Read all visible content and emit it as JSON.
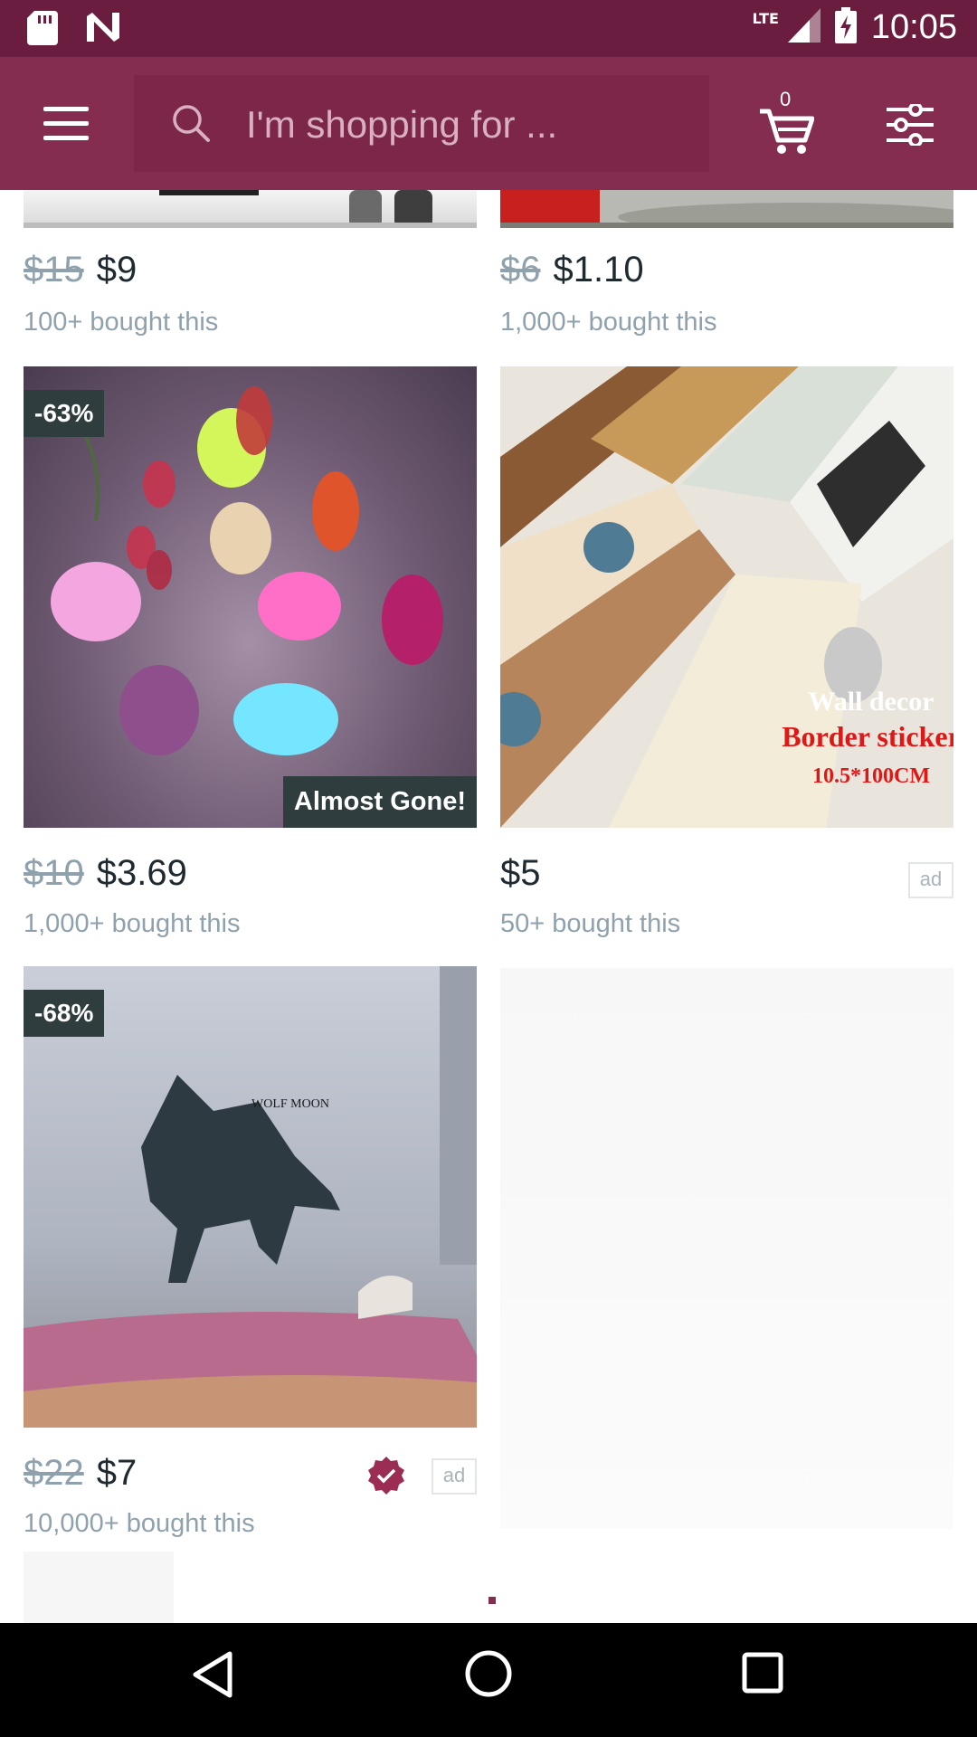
{
  "status_bar": {
    "time": "10:05",
    "network": "LTE",
    "icons": [
      "sd-card-icon",
      "n-notification-icon",
      "signal-icon",
      "battery-charging-icon"
    ]
  },
  "toolbar": {
    "search_placeholder": "I'm shopping for ...",
    "cart_count": "0",
    "background": "#852c51",
    "status_background": "#6a1d3e"
  },
  "products": [
    {
      "old_price": "$15",
      "price": "$9",
      "bought": "100+ bought this"
    },
    {
      "old_price": "$6",
      "price": "$1.10",
      "bought": "1,000+ bought this"
    },
    {
      "old_price": "$10",
      "price": "$3.69",
      "bought": "1,000+ bought this",
      "discount": "-63%",
      "badge": "Almost Gone!"
    },
    {
      "old_price": "",
      "price": "$5",
      "bought": "50+ bought this",
      "ad": "ad",
      "overlay": {
        "line1": "Wall decor",
        "line2": "Border sticker",
        "line3": "10.5*100CM"
      }
    },
    {
      "old_price": "$22",
      "price": "$7",
      "bought": "10,000+ bought this",
      "discount": "-68%",
      "ad": "ad",
      "image_text": "WOLF MOON"
    }
  ],
  "nav": {
    "back": "back-icon",
    "home": "home-icon",
    "recents": "recents-icon"
  }
}
